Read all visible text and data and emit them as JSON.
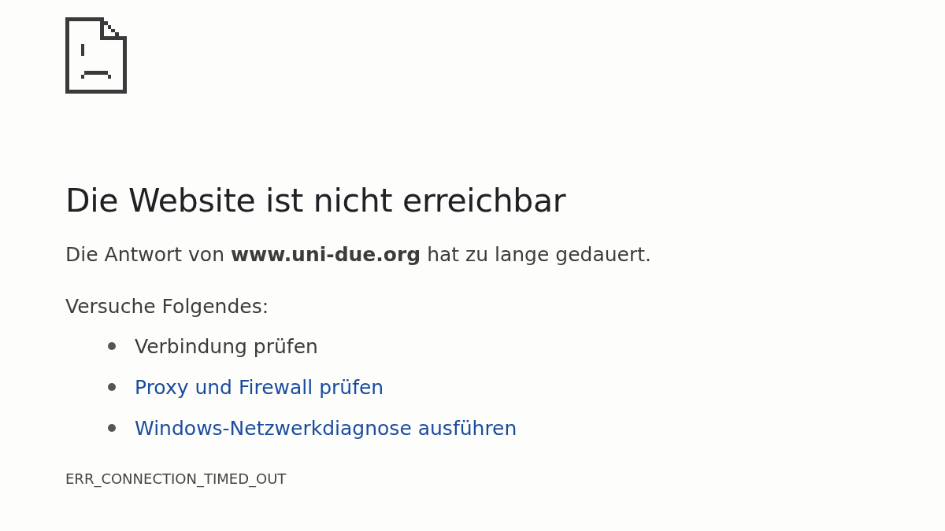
{
  "heading": "Die Website ist nicht erreichbar",
  "message": "Die Antwort von **www.uni-due.org** hat zu lange gedauert.",
  "suggestions_title": "Versuche Folgendes:",
  "suggestions": [
    {
      "kind": "text",
      "label": "Verbindung prüfen"
    },
    {
      "kind": "link",
      "label": "Proxy und Firewall prüfen"
    },
    {
      "kind": "link",
      "label": "Windows-Netzwerkdiagnose ausführen"
    }
  ],
  "error_code": "ERR_CONNECTION_TIMED_OUT"
}
